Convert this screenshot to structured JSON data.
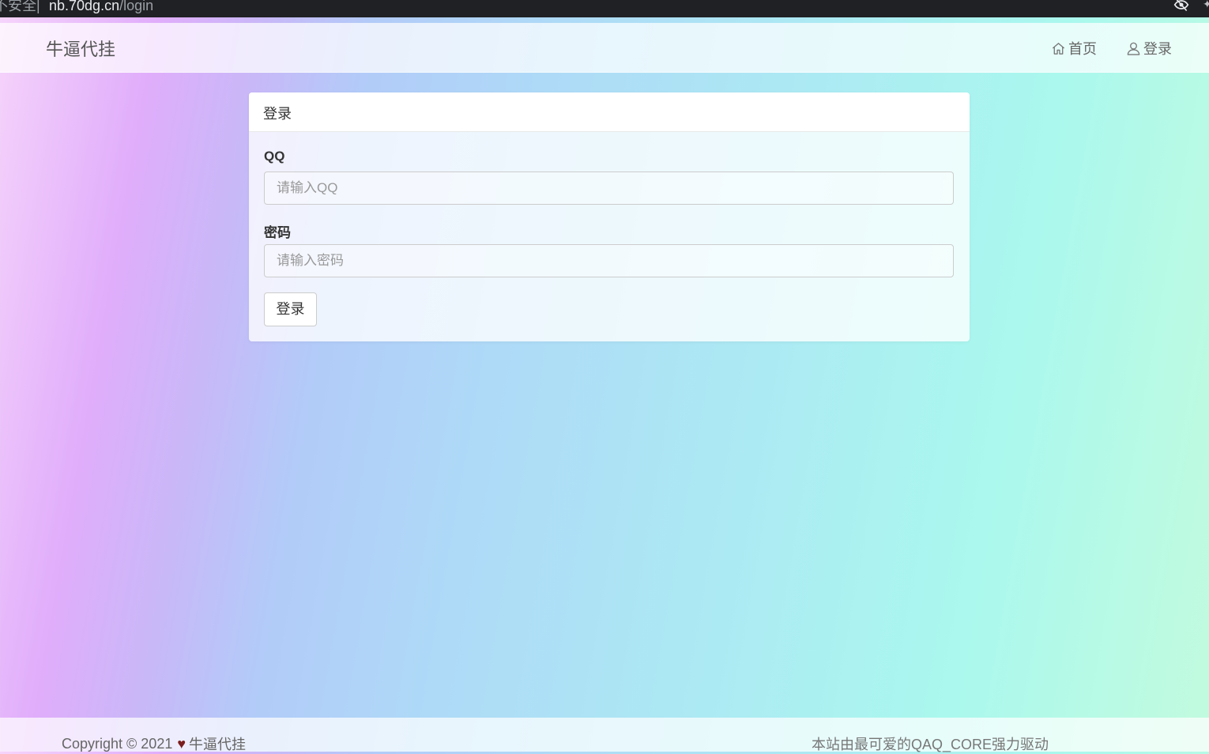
{
  "browser": {
    "security_text": "不安全",
    "separator": "|",
    "url_host": "nb.70dg.cn",
    "url_path": "/login"
  },
  "navbar": {
    "brand": "牛逼代挂",
    "home_label": "首页",
    "login_label": "登录"
  },
  "login_panel": {
    "title": "登录",
    "qq_label": "QQ",
    "qq_placeholder": "请输入QQ",
    "password_label": "密码",
    "password_placeholder": "请输入密码",
    "submit_label": "登录"
  },
  "footer": {
    "copyright": "Copyright © 2021",
    "heart": "♥",
    "site_name": "牛逼代挂",
    "powered_by": "本站由最可爱的QAQ_CORE强力驱动"
  }
}
